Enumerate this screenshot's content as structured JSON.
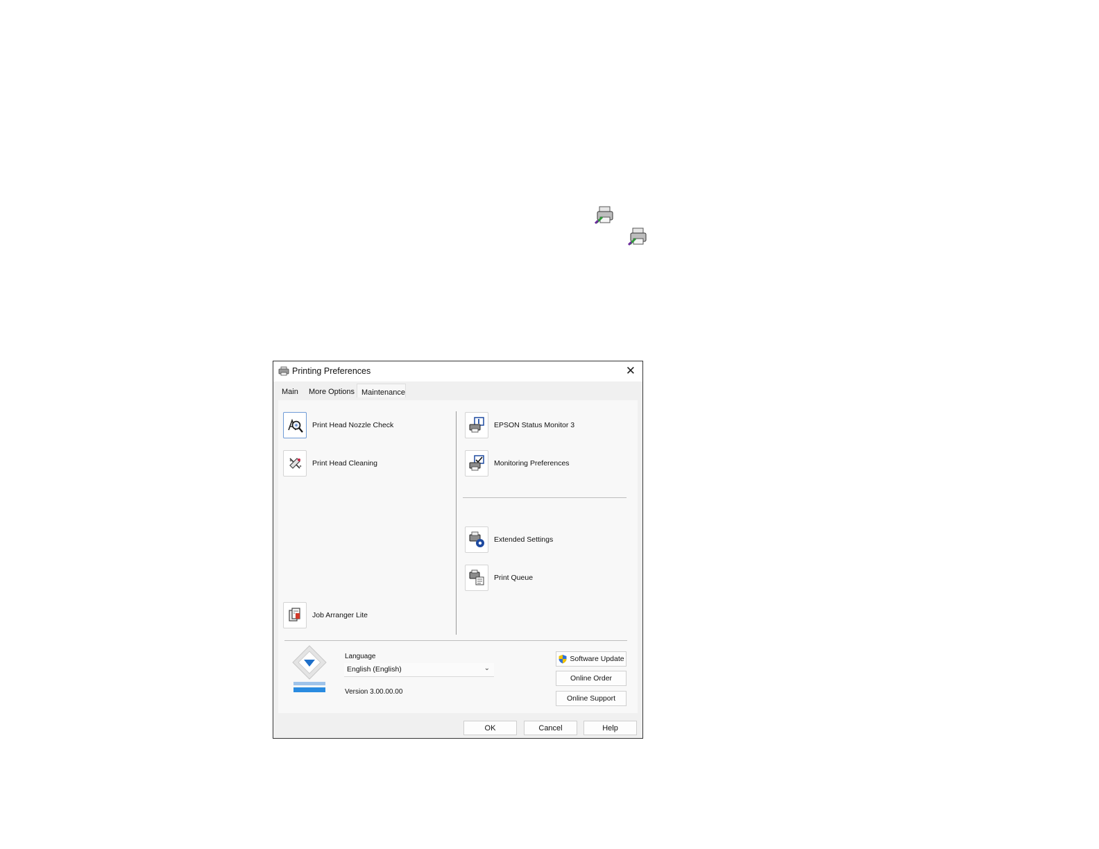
{
  "window": {
    "title": "Printing Preferences",
    "close_glyph": "✕"
  },
  "tabs": [
    {
      "label": "Main"
    },
    {
      "label": "More Options"
    },
    {
      "label": "Maintenance",
      "selected": true
    }
  ],
  "left_items": [
    {
      "label": "Print Head Nozzle Check",
      "icon": "nozzle-check-icon"
    },
    {
      "label": "Print Head Cleaning",
      "icon": "head-cleaning-icon"
    },
    {
      "label": "Job Arranger Lite",
      "icon": "job-arranger-icon"
    }
  ],
  "right_items": [
    {
      "label": "EPSON Status Monitor 3",
      "icon": "status-monitor-icon"
    },
    {
      "label": "Monitoring Preferences",
      "icon": "monitoring-preferences-icon"
    },
    {
      "label": "Extended Settings",
      "icon": "extended-settings-icon"
    },
    {
      "label": "Print Queue",
      "icon": "print-queue-icon"
    }
  ],
  "language": {
    "label": "Language",
    "value": "English (English)",
    "chevron": "⌄"
  },
  "version": "Version 3.00.00.00",
  "side_buttons": {
    "software_update": "Software Update",
    "online_order": "Online Order",
    "online_support": "Online Support"
  },
  "footer": {
    "ok": "OK",
    "cancel": "Cancel",
    "help": "Help"
  },
  "colors": {
    "accent": "#1e6fc9",
    "selection_border": "#6e9ad6",
    "shield_blue": "#2f6fd8",
    "shield_yellow": "#f2c200"
  }
}
